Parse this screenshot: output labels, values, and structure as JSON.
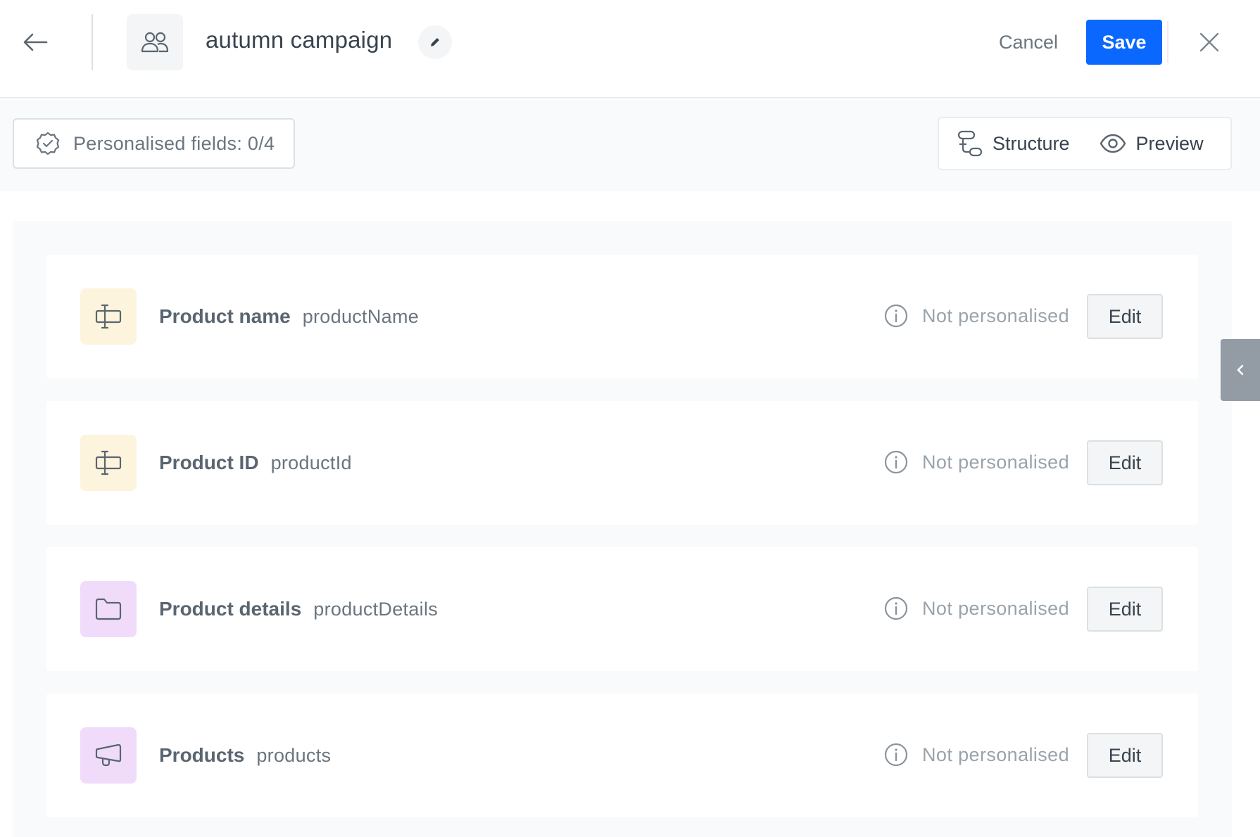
{
  "header": {
    "title": "autumn campaign",
    "back_icon": "arrow-left-icon",
    "campaign_icon": "users-icon",
    "rename_icon": "pencil-icon",
    "cancel_label": "Cancel",
    "save_label": "Save",
    "close_icon": "close-icon",
    "save_color": "#0b68ff"
  },
  "toolbar": {
    "personalised_label": "Personalised fields: 0/4",
    "personalised_icon": "badge-check-icon",
    "structure_label": "Structure",
    "preview_label": "Preview"
  },
  "fields": [
    {
      "title": "Product name",
      "key": "productName",
      "status": "Not personalised",
      "edit_label": "Edit",
      "icon": "text-field-icon",
      "icon_color": "#fdf4dd"
    },
    {
      "title": "Product ID",
      "key": "productId",
      "status": "Not personalised",
      "edit_label": "Edit",
      "icon": "text-field-icon",
      "icon_color": "#fdf4dd"
    },
    {
      "title": "Product details",
      "key": "productDetails",
      "status": "Not personalised",
      "edit_label": "Edit",
      "icon": "folder-icon",
      "icon_color": "#f0dcfa"
    },
    {
      "title": "Products",
      "key": "products",
      "status": "Not personalised",
      "edit_label": "Edit",
      "icon": "megaphone-icon",
      "icon_color": "#f0dcfa"
    }
  ],
  "side_toggle_icon": "chevron-left-icon"
}
